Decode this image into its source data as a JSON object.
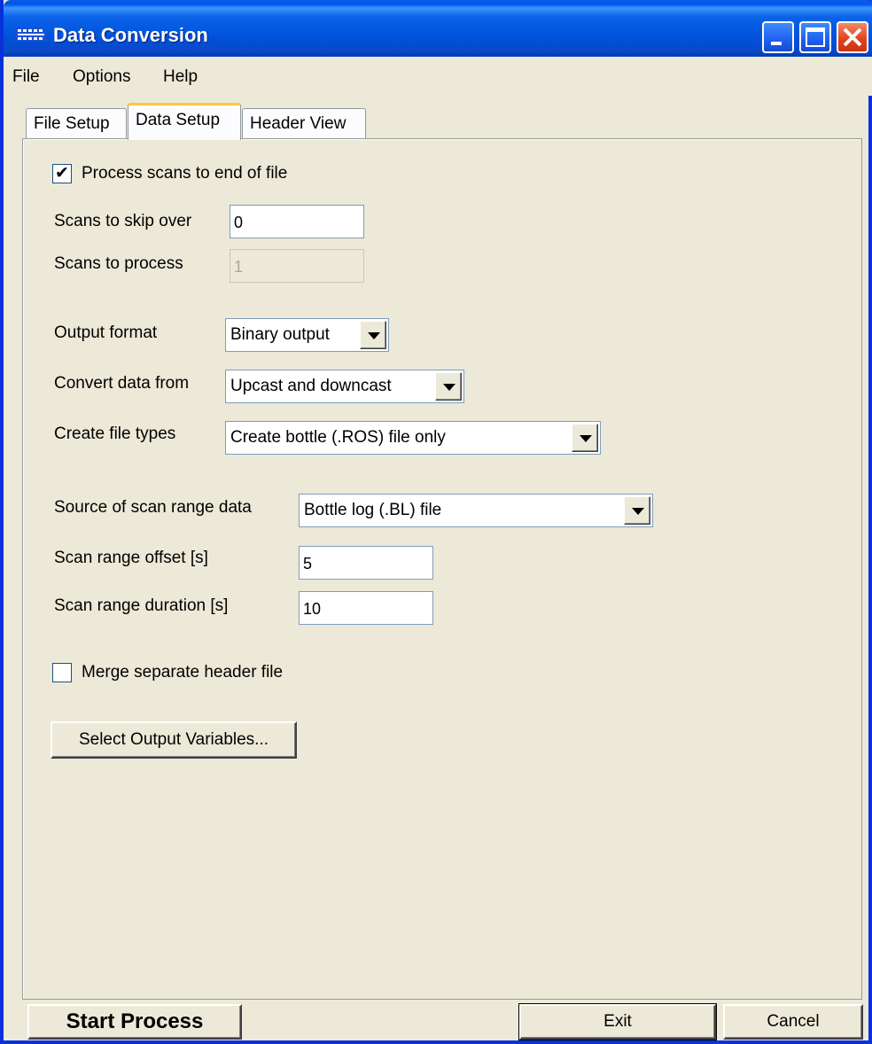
{
  "window": {
    "title": "Data Conversion"
  },
  "menu": {
    "items": [
      "File",
      "Options",
      "Help"
    ]
  },
  "tabs": [
    {
      "label": "File Setup",
      "active": false
    },
    {
      "label": "Data Setup",
      "active": true
    },
    {
      "label": "Header View",
      "active": false
    }
  ],
  "form": {
    "process_to_end": {
      "label": "Process scans to end of file",
      "checked": true
    },
    "scans_skip": {
      "label": "Scans to skip over",
      "value": "0"
    },
    "scans_process": {
      "label": "Scans to process",
      "value": "1",
      "disabled": true
    },
    "output_format": {
      "label": "Output format",
      "value": "Binary output"
    },
    "convert_from": {
      "label": "Convert data from",
      "value": "Upcast and downcast"
    },
    "create_types": {
      "label": "Create file types",
      "value": "Create bottle (.ROS) file only"
    },
    "scan_source": {
      "label": "Source of scan range data",
      "value": "Bottle log (.BL) file"
    },
    "scan_offset": {
      "label": "Scan range offset [s]",
      "value": "5"
    },
    "scan_duration": {
      "label": "Scan range duration [s]",
      "value": "10"
    },
    "merge_header": {
      "label": "Merge separate header file",
      "checked": false
    },
    "select_vars_label": "Select Output Variables..."
  },
  "footer": {
    "start_label": "Start Process",
    "exit_label": "Exit",
    "cancel_label": "Cancel"
  },
  "colors": {
    "title_bar": "#0058ee",
    "close_button": "#e0401b",
    "face": "#ece9d8"
  }
}
